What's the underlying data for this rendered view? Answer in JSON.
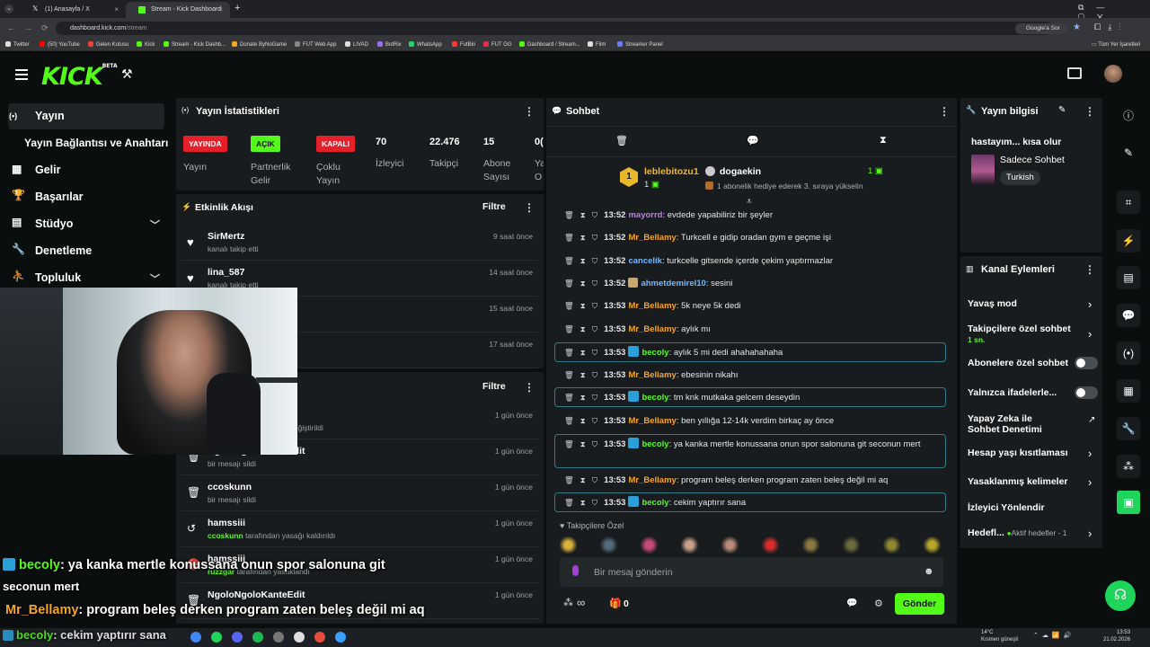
{
  "browser": {
    "tabs": [
      {
        "label": "(1) Anasayfa / X",
        "close": "×"
      },
      {
        "label": "Stream - Kick Dashboard",
        "close": "×"
      }
    ],
    "new_tab": "+",
    "url_host": "dashboard.kick.com",
    "url_path": "/stream",
    "search_engine": "Google'a Sor",
    "bookmarks": [
      "Twitter",
      "(50) YouTube",
      "Gelen Kutusu",
      "Kick",
      "Stream - Kick Dashb...",
      "Donate ByNoGame",
      "FUT Web App",
      "LIVAD",
      "BotRix",
      "WhatsApp",
      "FutBin",
      "FUT GG",
      "Dashboard / Stream...",
      "Film",
      "Streamer Panel"
    ],
    "all_bookmarks": "Tüm Yer İşaretleri"
  },
  "brand": {
    "logo": "KICK",
    "beta": "BETA",
    "accent": "#53fc18"
  },
  "sidebar": {
    "items": [
      {
        "label": "Yayın",
        "icon": "broadcast-icon"
      },
      {
        "label": "Yayın Bağlantısı ve Anahtarı"
      },
      {
        "label": "Gelir",
        "icon": "revenue-icon"
      },
      {
        "label": "Başarılar",
        "icon": "trophy-icon"
      },
      {
        "label": "Stüdyo",
        "icon": "studio-icon"
      },
      {
        "label": "Denetleme",
        "icon": "wrench-icon"
      },
      {
        "label": "Topluluk",
        "icon": "community-icon"
      }
    ]
  },
  "stats": {
    "title": "Yayın İstatistikleri",
    "badges": [
      {
        "text": "YAYINDA",
        "label": "Yayın",
        "color": "#e5202a"
      },
      {
        "text": "AÇIK",
        "label": "Partnerlik Gelir",
        "color": "#53fc18"
      },
      {
        "text": "KAPALI",
        "label": "Çoklu Yayın",
        "color": "#e5202a"
      }
    ],
    "numbers": [
      {
        "value": "70",
        "label": "İzleyici"
      },
      {
        "value": "22.476",
        "label": "Takipçi"
      },
      {
        "value": "15",
        "label": "Abone Sayısı"
      },
      {
        "value": "0(",
        "label": "Ya O"
      }
    ]
  },
  "activity": {
    "title": "Etkinlik Akışı",
    "filter": "Filtre",
    "events": [
      {
        "name": "SirMertz",
        "desc": "kanalı takip etti",
        "time": "9 saat önce"
      },
      {
        "name": "lina_587",
        "desc": "kanalı takip etti",
        "time": "14 saat önce"
      },
      {
        "name": "",
        "desc": "",
        "time": "15 saat önce"
      },
      {
        "name": "",
        "desc": "",
        "time": "17 saat önce"
      }
    ]
  },
  "modlog": {
    "filter": "Filtre",
    "events": [
      {
        "name": "",
        "desc_strong": "YAYIN DENEME",
        "desc": "olarak değiştirildi",
        "time": "1 gün önce"
      },
      {
        "name": "NgoloNgoloKanteEdit",
        "desc": "bir mesajı sildi",
        "time": "1 gün önce"
      },
      {
        "name": "ccoskunn",
        "desc": "bir mesajı sildi",
        "time": "1 gün önce"
      },
      {
        "name": "hamssiii",
        "desc_user": "ccoskunn",
        "desc": "tarafından yasağı kaldırıldı",
        "time": "1 gün önce"
      },
      {
        "name": "hamssiii",
        "desc_user": "ruzzgar",
        "desc": "tarafından yasaklandı",
        "time": "1 gün önce"
      },
      {
        "name": "NgoloNgoloKanteEdit",
        "desc": "",
        "time": "1 gün önce"
      }
    ]
  },
  "chat": {
    "title": "Sohbet",
    "gifter": {
      "name": "leblebitozu1",
      "count": "1",
      "rank": "1"
    },
    "recipient": {
      "name": "dogaekin",
      "count": "1",
      "text": "1 abonelik hediye ederek 3. sıraya yükselin"
    },
    "messages": [
      {
        "time": "13:52",
        "user": "mayorrd",
        "color": "#c47cf0",
        "text": "evdede yapabiliriz bir şeyler"
      },
      {
        "time": "13:52",
        "user": "Mr_Bellamy",
        "color": "#f5a623",
        "text": "Turkcell e gidip oradan gym e geçme işi"
      },
      {
        "time": "13:52",
        "user": "cancelik",
        "color": "#75b7ff",
        "text": "turkcelle gitsende içerde çekim yaptırmazlar"
      },
      {
        "time": "13:52",
        "user": "ahmetdemirel10",
        "color": "#75b7ff",
        "text": "sesini"
      },
      {
        "time": "13:53",
        "user": "Mr_Bellamy",
        "color": "#f5a623",
        "text": "5k neye 5k dedi"
      },
      {
        "time": "13:53",
        "user": "Mr_Bellamy",
        "color": "#f5a623",
        "text": "aylık mı"
      },
      {
        "time": "13:53",
        "user": "becoly",
        "color": "#53fc18",
        "text": "aylık 5 mi dedi ahahahahaha"
      },
      {
        "time": "13:53",
        "user": "Mr_Bellamy",
        "color": "#f5a623",
        "text": "ebesinin nikahı"
      },
      {
        "time": "13:53",
        "user": "becoly",
        "color": "#53fc18",
        "text": "tm knk mutkaka gelcem deseydin"
      },
      {
        "time": "13:53",
        "user": "Mr_Bellamy",
        "color": "#f5a623",
        "text": "ben yıllığa 12-14k verdim birkaç ay önce"
      },
      {
        "time": "13:53",
        "user": "becoly",
        "color": "#53fc18",
        "text": "ya kanka mertle konussana onun spor salonuna git seconun mert"
      },
      {
        "time": "13:53",
        "user": "Mr_Bellamy",
        "color": "#f5a623",
        "text": "program beleş derken program zaten beleş değil mi aq"
      },
      {
        "time": "13:53",
        "user": "becoly",
        "color": "#53fc18",
        "text": "cekim yaptırır sana"
      }
    ],
    "emote_label": "Takipçilere Özel",
    "input_placeholder": "Bir mesaj gönderin",
    "points": "0",
    "infinity": "∞",
    "send": "Gönder"
  },
  "info": {
    "title": "Yayın bilgisi",
    "stream_title": "hastayım... kısa olur",
    "category": "Sadece Sohbet",
    "tag": "Turkish"
  },
  "actions": {
    "title": "Kanal Eylemleri",
    "items": [
      {
        "label": "Yavaş mod",
        "control": "arrow"
      },
      {
        "label": "Takipçilere özel sohbet",
        "sub": "1 sn.",
        "control": "arrow"
      },
      {
        "label": "Abonelere özel sohbet",
        "control": "toggle"
      },
      {
        "label": "Yalnızca ifadelerle...",
        "control": "toggle"
      },
      {
        "label": "Yapay Zeka ile Sohbet Denetimi",
        "control": "external"
      },
      {
        "label": "Hesap yaşı kısıtlaması",
        "control": "arrow"
      },
      {
        "label": "Yasaklanmış kelimeler",
        "control": "arrow"
      },
      {
        "label": "İzleyici Yönlendir",
        "control": "none"
      },
      {
        "label": "Hedefl...",
        "sub": "Aktif hedefler - 1",
        "control": "arrow"
      }
    ]
  },
  "overlay": {
    "lines": [
      {
        "user": "becoly",
        "text": ": ya kanka mertle konussana onun spor salonuna git"
      },
      {
        "user": "",
        "text": "seconun mert"
      },
      {
        "user": "Mr_Bellamy",
        "text": ": program beleş derken program zaten beleş değil mi aq"
      },
      {
        "user": "becoly",
        "text": ": cekim yaptırır sana"
      }
    ]
  },
  "taskbar": {
    "weather": "14°C",
    "weather_desc": "Kısmen güneşli",
    "time": "13:53",
    "date": "21.02.2026"
  }
}
